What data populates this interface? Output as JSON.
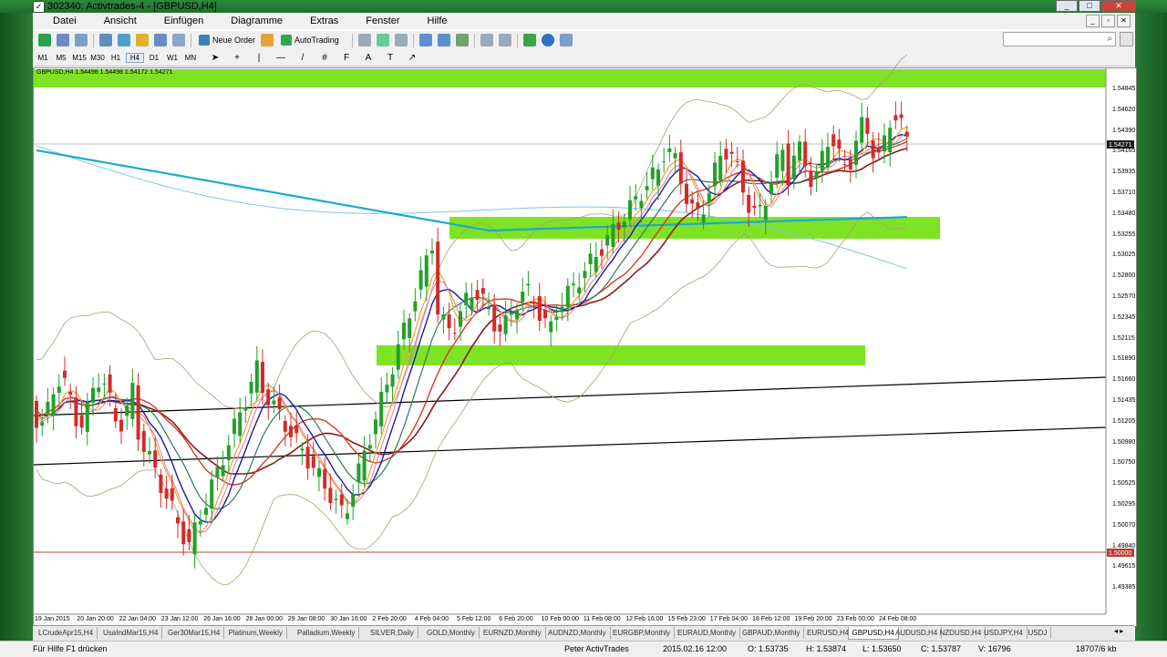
{
  "window": {
    "title": "302340: Activtrades-4 - [GBPUSD,H4]",
    "min_label": "_",
    "max_label": "□",
    "close_label": "✕"
  },
  "menu": [
    "Datei",
    "Ansicht",
    "Einfügen",
    "Diagramme",
    "Extras",
    "Fenster",
    "Hilfe"
  ],
  "toolbar": {
    "new_order_label": "Neue Order",
    "autotrading_label": "AutoTrading"
  },
  "timeframes": [
    "M1",
    "M5",
    "M15",
    "M30",
    "H1",
    "H4",
    "D1",
    "W1",
    "MN"
  ],
  "selected_timeframe": "H4",
  "chart": {
    "symbol_info": "GBPUSD,H4  1.54498 1.54498 1.54172 1.54271",
    "current_price_label": "1.54271",
    "alert_price_label": "1.50000",
    "price_labels": [
      "1.54845",
      "1.54620",
      "1.54390",
      "1.54165",
      "1.53935",
      "1.53710",
      "1.53480",
      "1.53255",
      "1.53025",
      "1.52800",
      "1.52570",
      "1.52345",
      "1.52115",
      "1.51890",
      "1.51660",
      "1.51435",
      "1.51205",
      "1.50980",
      "1.50750",
      "1.50525",
      "1.50295",
      "1.50070",
      "1.49840",
      "1.49615",
      "1.49385"
    ],
    "time_labels": [
      "19 Jan 2015",
      "20 Jan 20:00",
      "22 Jan 04:00",
      "23 Jan 12:00",
      "26 Jan 16:00",
      "28 Jan 00:00",
      "29 Jan 08:00",
      "30 Jan 16:00",
      "2 Feb 20:00",
      "4 Feb 04:00",
      "5 Feb 12:00",
      "6 Feb 20:00",
      "10 Feb 00:00",
      "11 Feb 08:00",
      "12 Feb 16:00",
      "15 Feb 23:00",
      "17 Feb 04:00",
      "18 Feb 12:00",
      "19 Feb 20:00",
      "23 Feb 00:00",
      "24 Feb 08:00"
    ]
  },
  "tabs": [
    "LCrudeApr15,H4",
    "UsaIndMar15,H4",
    "Ger30Mar15,H4",
    "Platinum,Weekly",
    "Palladium,Weekly",
    "SILVER,Daily",
    "GOLD,Monthly",
    "EURNZD,Monthly",
    "AUDNZD,Monthly",
    "EURGBP,Monthly",
    "EURAUD,Monthly",
    "GBPAUD,Monthly",
    "EURUSD,H4",
    "GBPUSD,H4",
    "AUDUSD,H4",
    "NZDUSD,H4",
    "USDJPY,H4",
    "USDJ"
  ],
  "active_tab": "GBPUSD,H4",
  "status": {
    "help": "Für Hilfe F1 drücken",
    "profile": "Peter ActivTrades",
    "datetime": "2015.02.16 12:00",
    "open": "O: 1.53735",
    "high": "H: 1.53874",
    "low": "L: 1.53650",
    "close": "C: 1.53787",
    "volume": "V: 16796",
    "traffic": "18707/6 kb"
  },
  "colors": {
    "zone": "#7ee324",
    "bull": "#22a02a",
    "bear": "#d42a2a",
    "ma_blue": "#1b1ba0",
    "ma_cyan": "#1ea8cc",
    "bands": "#a8a070"
  }
}
